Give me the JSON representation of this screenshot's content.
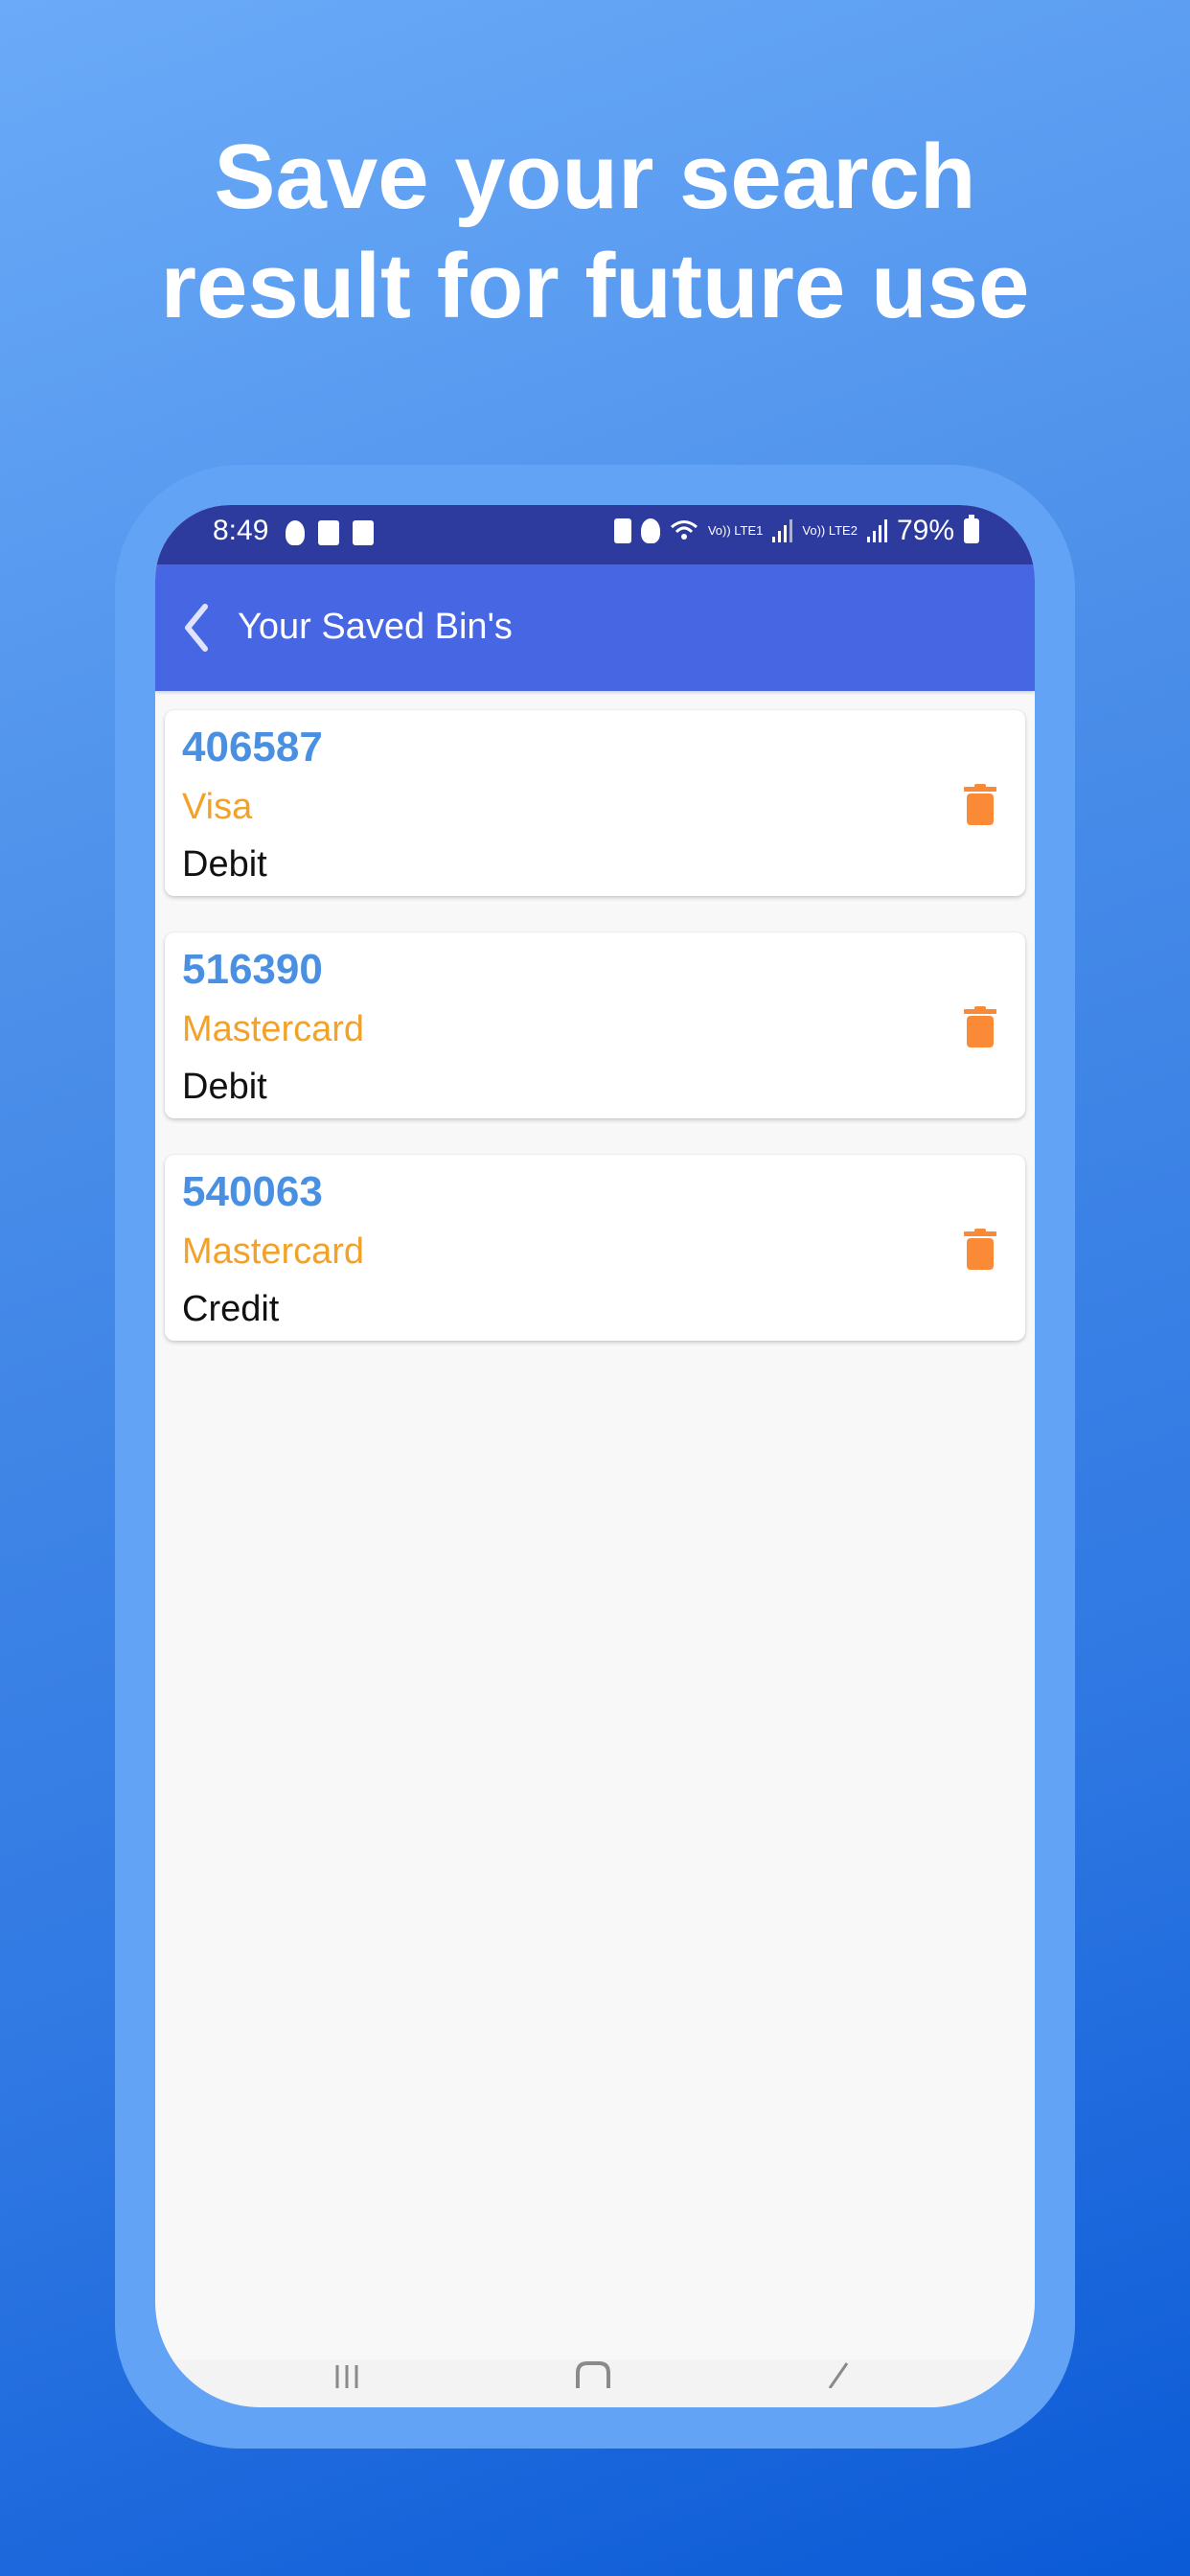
{
  "headline": {
    "line1": "Save your search",
    "line2": "result for future use"
  },
  "status_bar": {
    "time": "8:49",
    "network1_label": "Vo)) LTE1",
    "network2_label": "Vo)) LTE2",
    "battery": "79%"
  },
  "app_bar": {
    "title": "Your Saved Bin's",
    "back_icon": "chevron-left-icon"
  },
  "saved_bins": [
    {
      "bin": "406587",
      "brand": "Visa",
      "type": "Debit"
    },
    {
      "bin": "516390",
      "brand": "Mastercard",
      "type": "Debit"
    },
    {
      "bin": "540063",
      "brand": "Mastercard",
      "type": "Credit"
    }
  ],
  "colors": {
    "bin_text": "#4a90e2",
    "brand_text": "#f2a228",
    "delete_icon": "#fb8a36",
    "app_bar": "#4766e3",
    "status_bar": "#2e3b9e"
  },
  "nav_bar": {
    "icons": [
      "recent-apps-icon",
      "home-icon",
      "back-icon"
    ]
  }
}
